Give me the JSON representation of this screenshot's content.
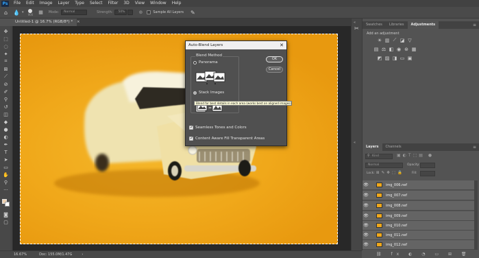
{
  "menubar": {
    "logo": "Ps",
    "items": [
      "File",
      "Edit",
      "Image",
      "Layer",
      "Type",
      "Select",
      "Filter",
      "3D",
      "View",
      "Window",
      "Help"
    ]
  },
  "options": {
    "brush_size": "900",
    "mode_label": "Mode:",
    "mode_value": "Normal",
    "strength_label": "Strength:",
    "strength_value": "50%",
    "sample_all_label": "Sample All Layers"
  },
  "document": {
    "tab_title": "Untitled-1 @ 16.7% (RGB/8*) *",
    "zoom": "16.67%",
    "doc_size": "Doc: 155.0M/1.47G"
  },
  "dialog": {
    "title": "Auto-Blend Layers",
    "blend_method_label": "Blend Method",
    "panorama_label": "Panorama",
    "stack_images_label": "Stack Images",
    "tooltip": "Blend for best details in each area (works best on aligned images)",
    "seamless_label": "Seamless Tones and Colors",
    "content_aware_label": "Content Aware Fill Transparent Areas",
    "ok_label": "OK",
    "cancel_label": "Cancel",
    "selected_method": "Stack Images"
  },
  "right_panels": {
    "tabs": [
      "Swatches",
      "Libraries",
      "Adjustments"
    ],
    "active_tab": "Adjustments",
    "add_adjustment": "Add an adjustment"
  },
  "layers_panel": {
    "tabs": [
      "Layers",
      "Channels"
    ],
    "active_tab": "Layers",
    "search_kind": "Kind",
    "blend_mode": "Normal",
    "opacity_label": "Opacity:",
    "lock_label": "Lock:",
    "fill_label": "Fill:",
    "layers": [
      "img_006.nef",
      "img_007.nef",
      "img_008.nef",
      "img_009.nef",
      "img_010.nef",
      "img_011.nef",
      "img_012.nef"
    ]
  },
  "colors": {
    "accent": "#31a8ff",
    "canvas_orange": "#f0a81a",
    "car_cream": "#efe6b8"
  }
}
